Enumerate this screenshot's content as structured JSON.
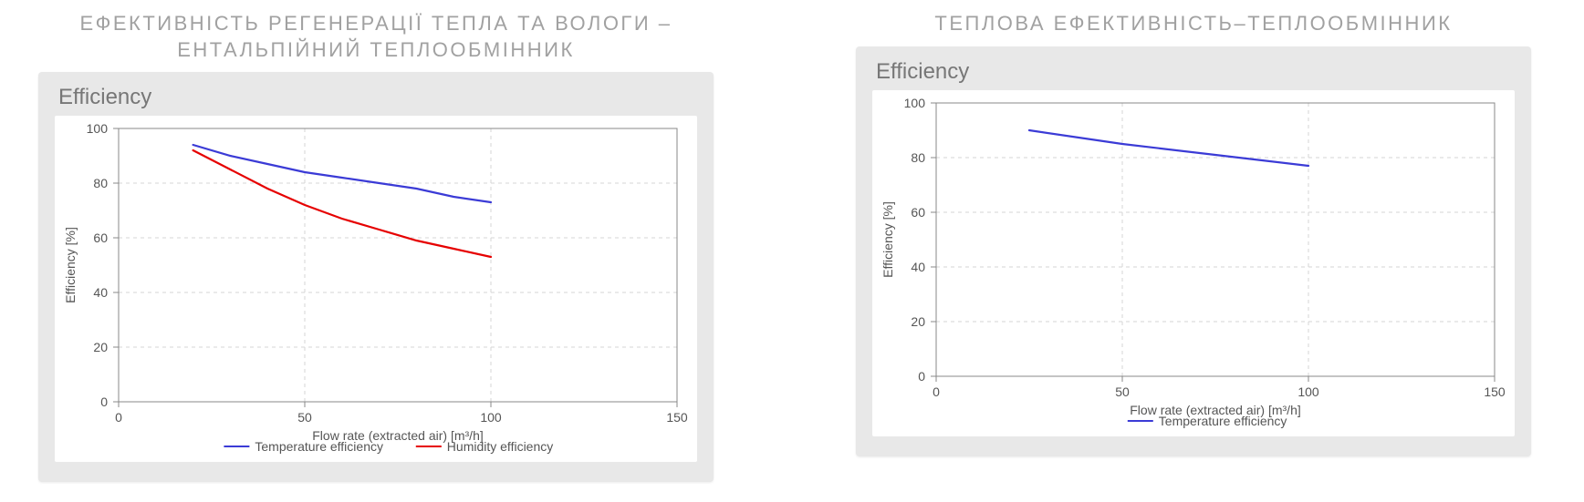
{
  "headings": {
    "left": "ЕФЕКТИВНІСТЬ РЕГЕНЕРАЦІЇ ТЕПЛА ТА ВОЛОГИ –\nЕНТАЛЬПІЙНИЙ ТЕПЛООБМІННИК",
    "right": "ТЕПЛОВА ЕФЕКТИВНІСТЬ–ТЕПЛООБМІННИК"
  },
  "card_title": "Efficiency",
  "axis": {
    "xlabel": "Flow rate (extracted air) [m³/h]",
    "ylabel": "Efficiency [%]"
  },
  "chart_data": [
    {
      "type": "line",
      "title": "Efficiency",
      "xlabel": "Flow rate (extracted air) [m³/h]",
      "ylabel": "Efficiency [%]",
      "xlim": [
        0,
        150
      ],
      "ylim": [
        0,
        100
      ],
      "xticks": [
        0,
        50,
        100,
        150
      ],
      "yticks": [
        0,
        20,
        40,
        60,
        80,
        100
      ],
      "grid": true,
      "legend_position": "bottom",
      "series": [
        {
          "name": "Temperature efficiency",
          "color": "#3b3bd6",
          "x": [
            20,
            30,
            40,
            50,
            60,
            70,
            80,
            90,
            100
          ],
          "values": [
            94,
            90,
            87,
            84,
            82,
            80,
            78,
            75,
            73
          ]
        },
        {
          "name": "Humidity efficiency",
          "color": "#e60000",
          "x": [
            20,
            30,
            40,
            50,
            60,
            70,
            80,
            90,
            100
          ],
          "values": [
            92,
            85,
            78,
            72,
            67,
            63,
            59,
            56,
            53
          ]
        }
      ]
    },
    {
      "type": "line",
      "title": "Efficiency",
      "xlabel": "Flow rate (extracted air) [m³/h]",
      "ylabel": "Efficiency [%]",
      "xlim": [
        0,
        150
      ],
      "ylim": [
        0,
        100
      ],
      "xticks": [
        0,
        50,
        100,
        150
      ],
      "yticks": [
        0,
        20,
        40,
        60,
        80,
        100
      ],
      "grid": true,
      "legend_position": "bottom",
      "series": [
        {
          "name": "Temperature efficiency",
          "color": "#3b3bd6",
          "x": [
            25,
            50,
            75,
            100
          ],
          "values": [
            90,
            85,
            81,
            77
          ]
        }
      ]
    }
  ]
}
